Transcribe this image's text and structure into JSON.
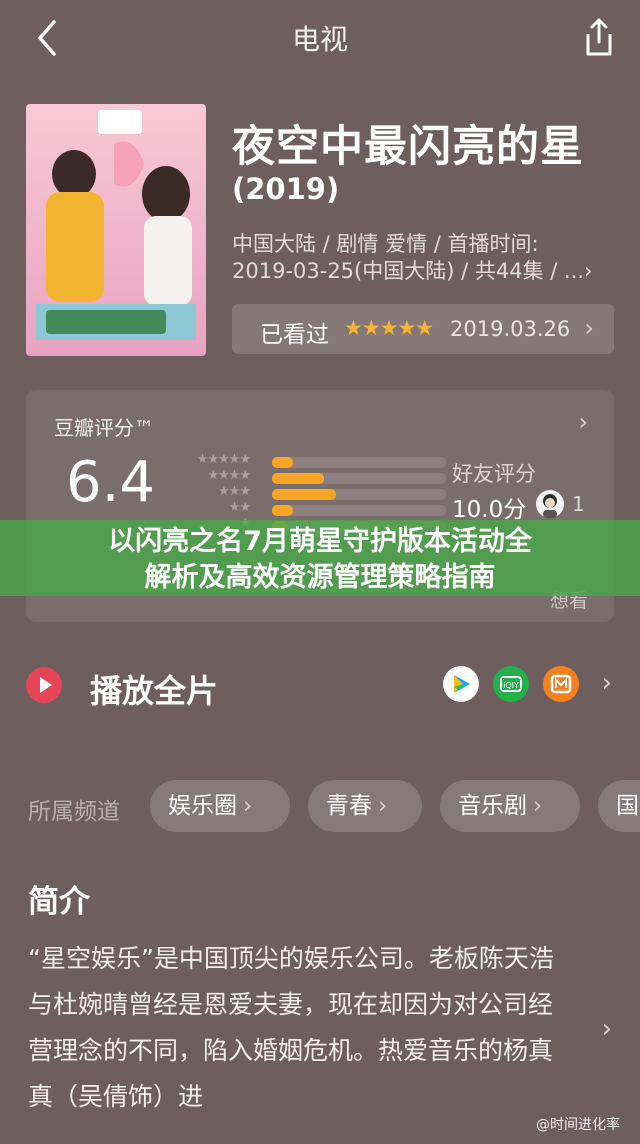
{
  "header": {
    "title": "电视"
  },
  "movie": {
    "title": "夜空中最闪亮的星",
    "year": "(2019)",
    "meta_line1": "中国大陆 / 剧情 爱情 / 首播时间:",
    "meta_line2": "2019-03-25(中国大陆) / 共44集 / ...›"
  },
  "watched": {
    "label": "已看过",
    "stars": "★★★★★",
    "date": "2019.03.26",
    "chevron": "›"
  },
  "rating": {
    "label": "豆瓣评分™",
    "score": "6.4",
    "distribution": [
      {
        "stars": "★★★★★",
        "fraction": 0.12
      },
      {
        "stars": "★★★★",
        "fraction": 0.3
      },
      {
        "stars": "★★★",
        "fraction": 0.37
      },
      {
        "stars": "★★",
        "fraction": 0.12
      },
      {
        "stars": "★",
        "fraction": 0.09
      }
    ],
    "friends_label": "好友评分",
    "friends_score": "10.0分",
    "friends_count": "1",
    "want_label": "想看"
  },
  "banner": {
    "line1": "以闪亮之名7月萌星守护版本活动全",
    "line2": "解析及高效资源管理策略指南"
  },
  "play": {
    "label": "播放全片",
    "platforms": [
      {
        "icon": "tencent-video-icon",
        "color": "#ffffff"
      },
      {
        "icon": "iqiyi-icon",
        "color": "#22b14c"
      },
      {
        "icon": "mango-tv-icon",
        "color": "#f4811f"
      }
    ]
  },
  "channels": {
    "label": "所属频道",
    "items": [
      "娱乐圈",
      "青春",
      "音乐剧",
      "国"
    ]
  },
  "synopsis": {
    "title": "简介",
    "text": "“星空娱乐”是中国顶尖的娱乐公司。老板陈天浩与杜婉晴曾经是恩爱夫妻，现在却因为对公司经营理念的不同，陷入婚姻危机。热爱音乐的杨真真（吴倩饰）进"
  },
  "watermark": "@时间进化率"
}
